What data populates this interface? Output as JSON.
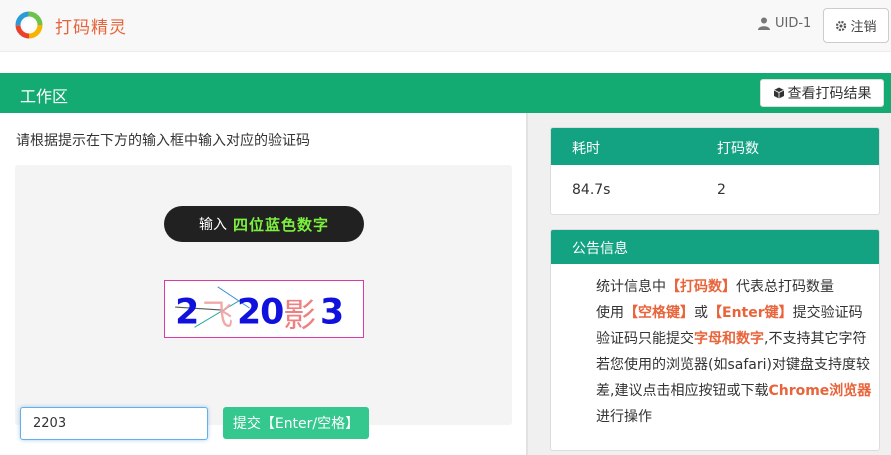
{
  "header": {
    "app_name": "打码精灵",
    "user_id": "UID-1",
    "logout_label": "注销"
  },
  "workbar": {
    "title": "工作区",
    "view_results_label": "查看打码结果"
  },
  "workspace": {
    "instruction": "请根据提示在下方的输入框中输入对应的验证码",
    "prompt_prefix": "输入",
    "prompt_target": "四位蓝色数字",
    "captcha_text": "2飞20影3",
    "answer_value": "2203",
    "submit_label": "提交【Enter/空格】"
  },
  "stats": {
    "headers": [
      "耗时",
      "打码数"
    ],
    "values": [
      "84.7s",
      "2"
    ]
  },
  "notice": {
    "title": "公告信息",
    "lines": [
      [
        "统计信息中",
        "【打码数】",
        "代表总打码数量"
      ],
      [
        "使用",
        "【空格键】",
        "或",
        "【Enter键】",
        "提交验证码"
      ],
      [
        "验证码只能提交",
        "字母和数字",
        ",不支持其它字符"
      ],
      [
        "若您使用的浏览器(如safari)对键盘支持度较"
      ],
      [
        "差,建议点击相应按钮或下载",
        "Chrome浏览器"
      ],
      [
        "进行操作"
      ]
    ]
  },
  "colors": {
    "accent_green": "#13ab72",
    "card_header_green": "#13a383",
    "submit_green": "#34c88e",
    "brand_orange": "#e8643a",
    "prompt_highlight": "#7df03e",
    "captcha_border": "#d83aa6",
    "captcha_blue_digit": "#1111dd",
    "captcha_pink_char": "#f08080"
  },
  "icons": {
    "logo": "rainbow-ring-logo-icon",
    "user": "user-icon",
    "logout": "gear-icon",
    "results": "cube-icon"
  }
}
